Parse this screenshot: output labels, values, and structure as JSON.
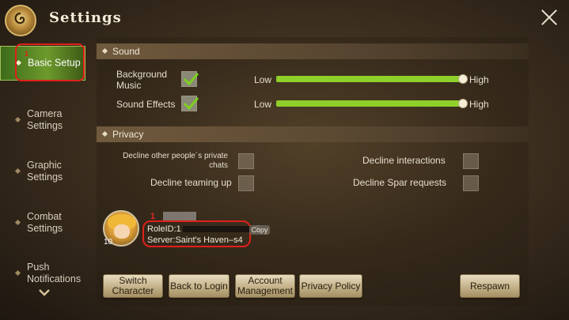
{
  "header": {
    "title": "Settings"
  },
  "sidebar": {
    "items": [
      {
        "label": "Basic Setup"
      },
      {
        "label": "Camera\nSettings"
      },
      {
        "label": "Graphic\nSettings"
      },
      {
        "label": "Combat\nSettings"
      },
      {
        "label": "Push\nNotifications"
      }
    ]
  },
  "sound": {
    "title": "Sound",
    "background_music": {
      "label": "Background\nMusic",
      "checked": true,
      "low": "Low",
      "high": "High",
      "level": 1.0
    },
    "sound_effects": {
      "label": "Sound Effects",
      "checked": true,
      "low": "Low",
      "high": "High",
      "level": 1.0
    }
  },
  "privacy": {
    "title": "Privacy",
    "decline_private_chats": "Decline other people´s private\nchats",
    "decline_interactions": "Decline interactions",
    "decline_teaming": "Decline teaming up",
    "decline_spar": "Decline Spar requests"
  },
  "profile": {
    "level": "10",
    "role_id": "RoleID:1",
    "role_id_tail": "5",
    "server": "Server:Saint's Haven–s4",
    "copy_label": "Copy",
    "mark": "1"
  },
  "buttons": {
    "switch_character": "Switch\nCharacter",
    "back_to_login": "Back to Login",
    "account_management": "Account\nManagement",
    "privacy_policy": "Privacy Policy",
    "respawn": "Respawn"
  },
  "annotations": {
    "sidebar_mark": "1"
  },
  "colors": {
    "accent_green": "#8fcf2a",
    "highlight_red": "#e0201a",
    "button_bg": "#c7b58e"
  }
}
